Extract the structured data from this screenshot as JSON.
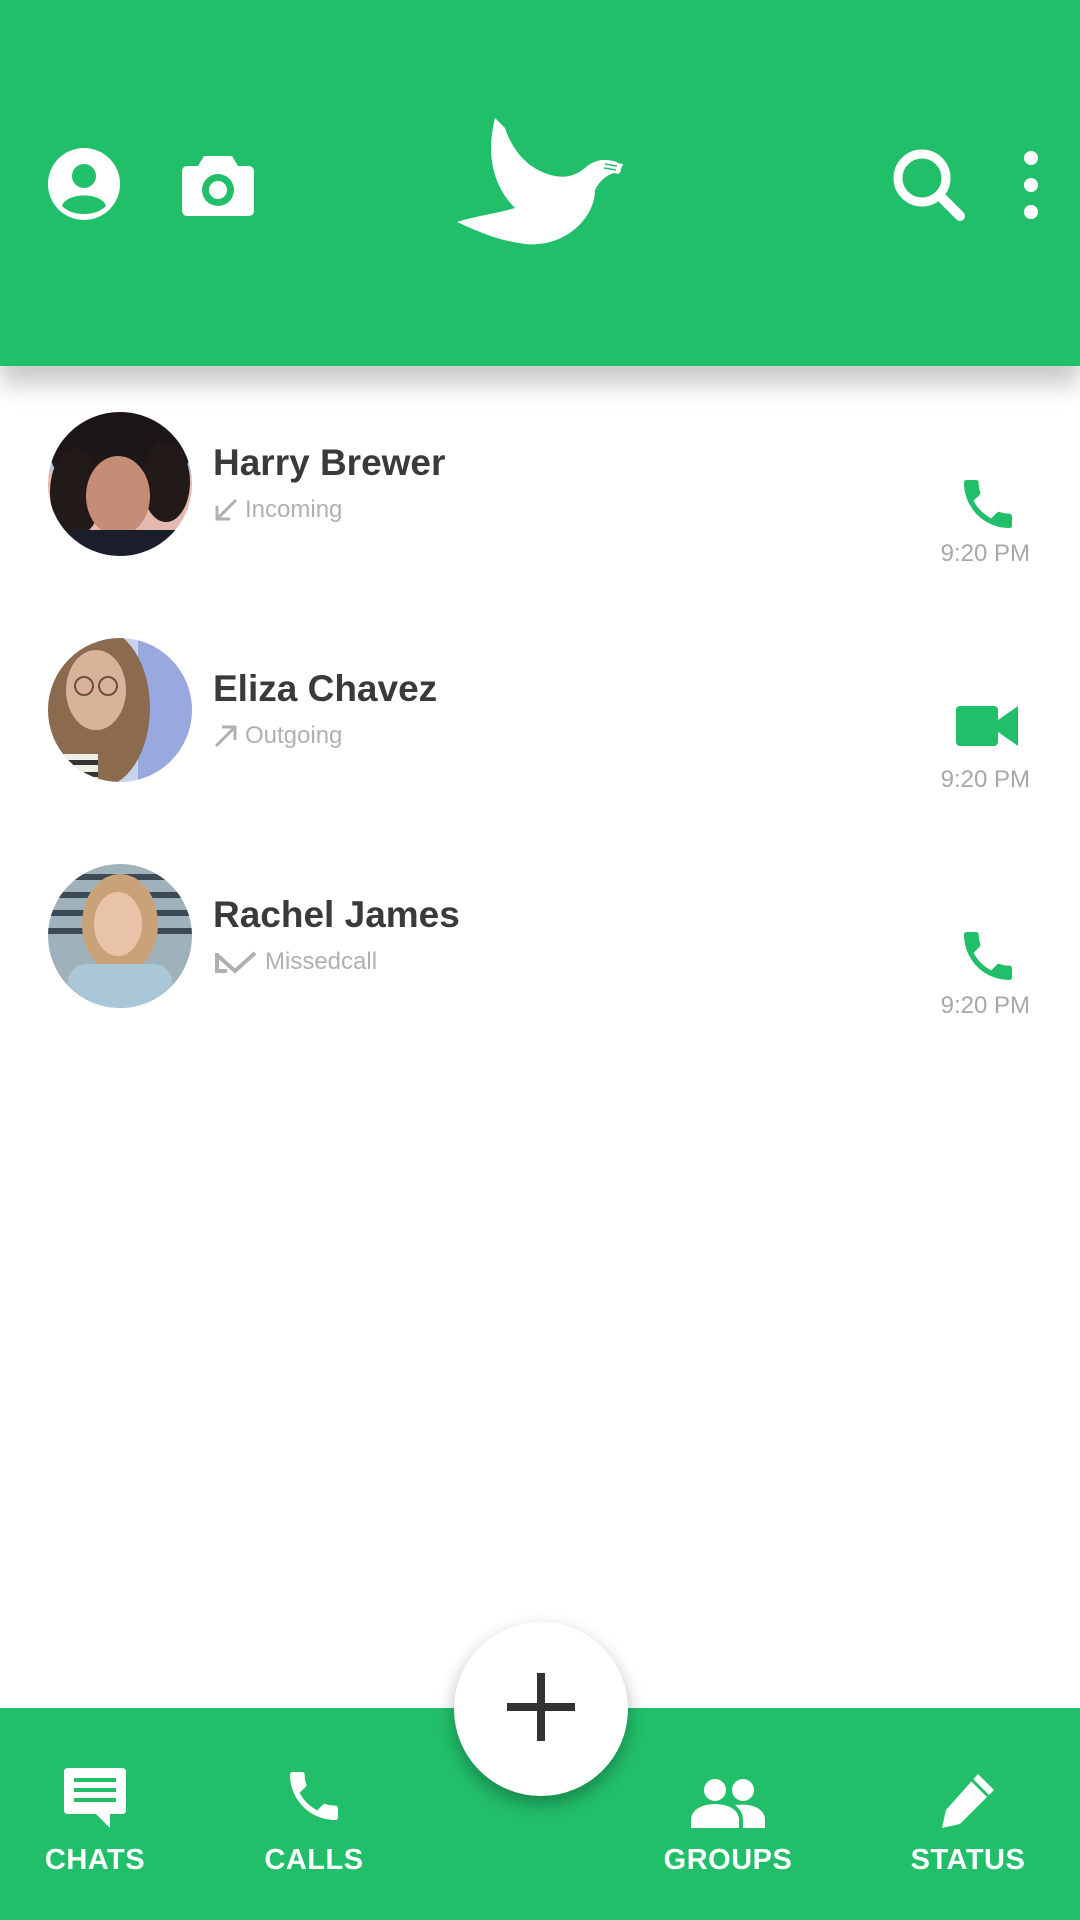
{
  "theme": {
    "accent": "#22bf6a",
    "text_dark": "#3a3a3a",
    "text_muted": "#b0b0b0"
  },
  "header": {
    "left_icons": [
      "profile-icon",
      "camera-icon"
    ],
    "logo": "dove-logo",
    "right_icons": [
      "search-icon",
      "more-vertical-icon"
    ]
  },
  "calls": [
    {
      "name": "Harry Brewer",
      "direction": "Incoming",
      "direction_icon": "arrow-incoming-icon",
      "call_type": "phone-icon",
      "time": "9:20 PM"
    },
    {
      "name": "Eliza Chavez",
      "direction": "Outgoing",
      "direction_icon": "arrow-outgoing-icon",
      "call_type": "video-icon",
      "time": "9:20 PM"
    },
    {
      "name": "Rachel James",
      "direction": "Missedcall",
      "direction_icon": "missed-call-icon",
      "call_type": "phone-icon",
      "time": "9:20 PM"
    }
  ],
  "fab": {
    "icon": "plus-icon"
  },
  "nav": [
    {
      "label": "CHATS",
      "icon": "chat-icon"
    },
    {
      "label": "CALLS",
      "icon": "phone-icon"
    },
    {
      "label": "GROUPS",
      "icon": "groups-icon"
    },
    {
      "label": "STATUS",
      "icon": "pencil-icon"
    }
  ]
}
